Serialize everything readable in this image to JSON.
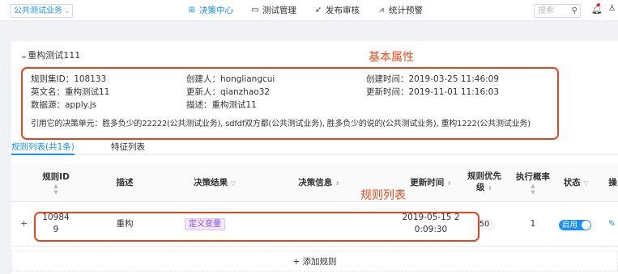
{
  "topbar": {
    "biz_select": "公共测试业务",
    "nav": [
      {
        "label": "决策中心",
        "icon": "grid-icon",
        "active": true
      },
      {
        "label": "测试管理",
        "icon": "monitor-icon",
        "active": false
      },
      {
        "label": "发布审核",
        "icon": "rocket-icon",
        "active": false
      },
      {
        "label": "统计预警",
        "icon": "chart-icon",
        "active": false
      }
    ],
    "search_placeholder": "搜索"
  },
  "ruleset": {
    "title": "重构测试111",
    "annotation_props": "基本属性",
    "props": {
      "id_label": "规则集ID：",
      "id_value": "108133",
      "creator_label": "创建人：",
      "creator_value": "hongliangcui",
      "created_label": "创建时间：",
      "created_value": "2019-03-25 11:46:09",
      "en_label": "英文名：",
      "en_value": "重构测试11",
      "updater_label": "更新人：",
      "updater_value": "qianzhao32",
      "updated_label": "更新时间：",
      "updated_value": "2019-11-01 11:16:03",
      "source_label": "数据源：",
      "source_value": "apply.js",
      "desc_label": "描述：",
      "desc_value": "重构测试11",
      "ref_label": "引用它的决策单元：",
      "ref_value": "胜多负少的22222(公共测试业务), sdfdf双方都(公共测试业务), 胜多负少的说的(公共测试业务), 重构1222(公共测试业务)"
    }
  },
  "tabs": [
    {
      "label": "规则列表(共1条)",
      "active": true
    },
    {
      "label": "特征列表",
      "active": false
    }
  ],
  "table": {
    "annotation": "规则列表",
    "headers": {
      "id": "规则ID",
      "desc": "描述",
      "result": "决策结果",
      "info": "决策信息",
      "updated": "更新时间",
      "priority_1": "规则优先",
      "priority_2": "级",
      "rate": "执行概率",
      "status": "状态",
      "op": "操"
    },
    "rows": [
      {
        "id_1": "10984",
        "id_2": "9",
        "desc": "重构",
        "result": "定义变量",
        "info": "",
        "updated_1": "2019-05-15 2",
        "updated_2": "0:09:30",
        "priority": "50",
        "rate": "1",
        "status": "启用"
      }
    ],
    "add_rule": "+ 添加规则"
  }
}
